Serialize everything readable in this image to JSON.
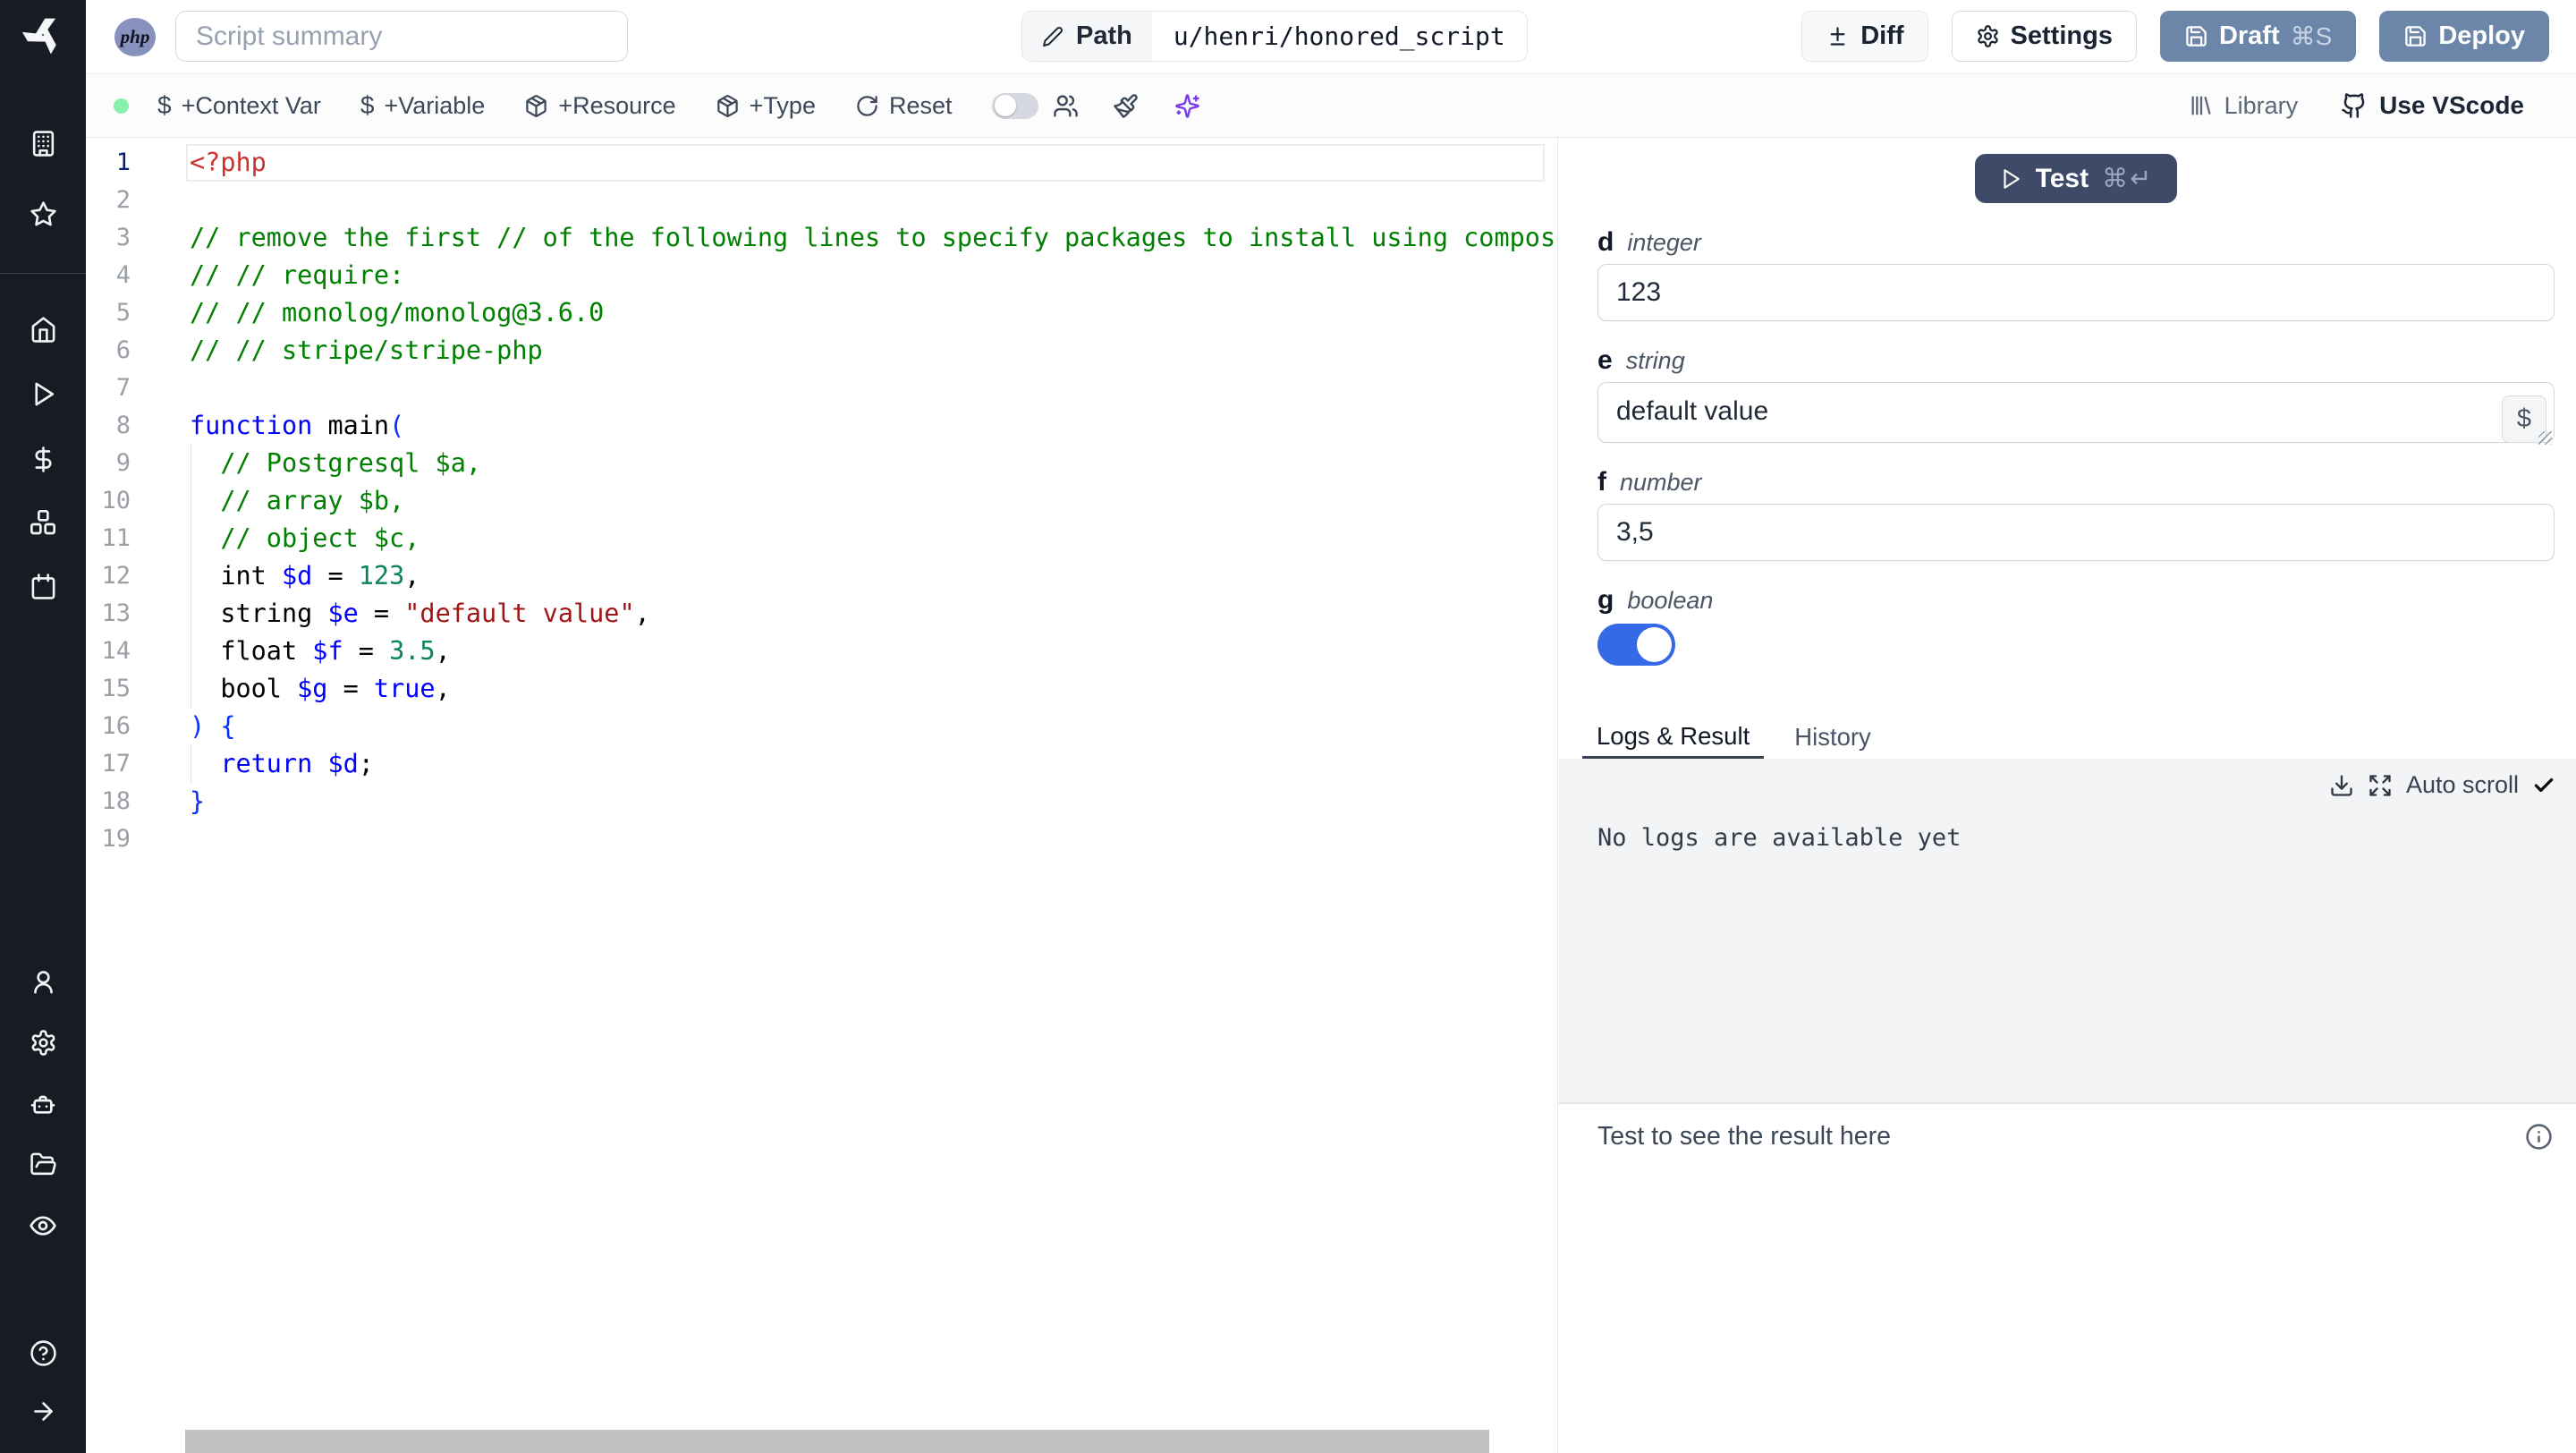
{
  "colors": {
    "primary_button": "#6c86a9",
    "test_button": "#3d4a68",
    "toggle_on": "#3569e6",
    "status_dot": "#86efac",
    "ai_sparkles": "#7c3aed",
    "language_badge_bg": "#8892bf"
  },
  "sidebar": {
    "icons": [
      "windmill-logo",
      "building",
      "star",
      "home",
      "play",
      "dollar",
      "boxes",
      "calendar",
      "user",
      "settings",
      "bot",
      "folder-open",
      "eye",
      "help",
      "arrow-right"
    ]
  },
  "topbar": {
    "language_badge": "php",
    "summary_placeholder": "Script summary",
    "path_label": "Path",
    "path_value": "u/henri/honored_script",
    "diff_label": "Diff",
    "settings_label": "Settings",
    "draft_label": "Draft",
    "draft_shortcut": "⌘S",
    "deploy_label": "Deploy"
  },
  "toolbar": {
    "dollar_symbol": "$",
    "add_context_var": "+Context Var",
    "add_variable": "+Variable",
    "add_resource": "+Resource",
    "add_type": "+Type",
    "reset": "Reset",
    "library": "Library",
    "use_vscode": "Use VScode"
  },
  "editor": {
    "language": "php",
    "palette": {
      "tag": "#cd3131",
      "com": "#008000",
      "kw": "#0000ff",
      "pln": "#000000",
      "num": "#098658",
      "str": "#a31515",
      "par": "#0431fa",
      "var": "#0000ff"
    },
    "lines": [
      {
        "n": 1,
        "current": true,
        "tokens": [
          [
            "tag",
            "<?php"
          ]
        ]
      },
      {
        "n": 2,
        "tokens": []
      },
      {
        "n": 3,
        "tokens": [
          [
            "com",
            "// remove the first // of the following lines to specify packages to install using composer"
          ]
        ]
      },
      {
        "n": 4,
        "tokens": [
          [
            "com",
            "// // require:"
          ]
        ]
      },
      {
        "n": 5,
        "tokens": [
          [
            "com",
            "// // monolog/monolog@3.6.0"
          ]
        ]
      },
      {
        "n": 6,
        "tokens": [
          [
            "com",
            "// // stripe/stripe-php"
          ]
        ]
      },
      {
        "n": 7,
        "tokens": []
      },
      {
        "n": 8,
        "tokens": [
          [
            "kw",
            "function"
          ],
          [
            "pln",
            " main"
          ],
          [
            "par",
            "("
          ]
        ]
      },
      {
        "n": 9,
        "guide": true,
        "tokens": [
          [
            "com",
            "  // Postgresql $a,"
          ]
        ]
      },
      {
        "n": 10,
        "guide": true,
        "tokens": [
          [
            "com",
            "  // array $b,"
          ]
        ]
      },
      {
        "n": 11,
        "guide": true,
        "tokens": [
          [
            "com",
            "  // object $c,"
          ]
        ]
      },
      {
        "n": 12,
        "guide": true,
        "tokens": [
          [
            "pln",
            "  int "
          ],
          [
            "var",
            "$d"
          ],
          [
            "pln",
            " = "
          ],
          [
            "num",
            "123"
          ],
          [
            "pln",
            ","
          ]
        ]
      },
      {
        "n": 13,
        "guide": true,
        "tokens": [
          [
            "pln",
            "  string "
          ],
          [
            "var",
            "$e"
          ],
          [
            "pln",
            " = "
          ],
          [
            "str",
            "\"default value\""
          ],
          [
            "pln",
            ","
          ]
        ]
      },
      {
        "n": 14,
        "guide": true,
        "tokens": [
          [
            "pln",
            "  float "
          ],
          [
            "var",
            "$f"
          ],
          [
            "pln",
            " = "
          ],
          [
            "num",
            "3.5"
          ],
          [
            "pln",
            ","
          ]
        ]
      },
      {
        "n": 15,
        "guide": true,
        "tokens": [
          [
            "pln",
            "  bool "
          ],
          [
            "var",
            "$g"
          ],
          [
            "pln",
            " = "
          ],
          [
            "kw",
            "true"
          ],
          [
            "pln",
            ","
          ]
        ]
      },
      {
        "n": 16,
        "tokens": [
          [
            "par",
            ") {"
          ]
        ]
      },
      {
        "n": 17,
        "guide": true,
        "tokens": [
          [
            "pln",
            "  "
          ],
          [
            "kw",
            "return"
          ],
          [
            "pln",
            " "
          ],
          [
            "var",
            "$d"
          ],
          [
            "pln",
            ";"
          ]
        ]
      },
      {
        "n": 18,
        "tokens": [
          [
            "par",
            "}"
          ]
        ]
      },
      {
        "n": 19,
        "tokens": []
      }
    ]
  },
  "runner": {
    "test_label": "Test",
    "test_shortcut": "⌘↵",
    "insert_var_symbol": "$",
    "fields": [
      {
        "name": "d",
        "type": "integer",
        "value": "123"
      },
      {
        "name": "e",
        "type": "string",
        "value": "default value"
      },
      {
        "name": "f",
        "type": "number",
        "value": "3,5"
      },
      {
        "name": "g",
        "type": "boolean",
        "value": "true"
      }
    ]
  },
  "tabs": {
    "logs": "Logs & Result",
    "history": "History",
    "active": "Logs & Result"
  },
  "logs": {
    "auto_scroll_label": "Auto scroll",
    "empty_message": "No logs are available yet"
  },
  "result": {
    "placeholder": "Test to see the result here"
  }
}
